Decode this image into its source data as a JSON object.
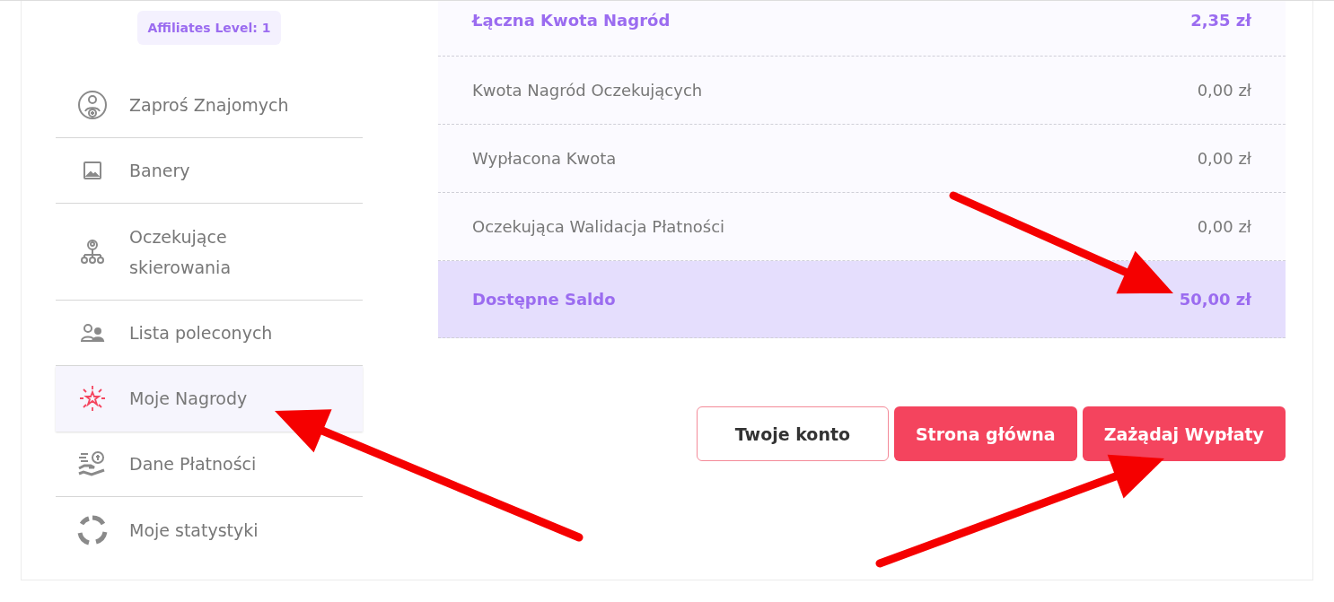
{
  "sidebar": {
    "badge": "Affiliates Level: 1",
    "items": [
      {
        "label": "Zaproś Znajomych",
        "selected": false
      },
      {
        "label": "Banery",
        "selected": false
      },
      {
        "label": "Oczekujące skierowania",
        "selected": false
      },
      {
        "label": "Lista poleconych",
        "selected": false
      },
      {
        "label": "Moje Nagrody",
        "selected": true
      },
      {
        "label": "Dane Płatności",
        "selected": false
      },
      {
        "label": "Moje statystyki",
        "selected": false
      }
    ]
  },
  "summary": {
    "rows": [
      {
        "kind": "total",
        "label": "Łączna Kwota Nagród",
        "value": "2,35 zł"
      },
      {
        "kind": "item",
        "label": "Kwota Nagród Oczekujących",
        "value": "0,00 zł"
      },
      {
        "kind": "item",
        "label": "Wypłacona Kwota",
        "value": "0,00 zł"
      },
      {
        "kind": "item",
        "label": "Oczekująca Walidacja Płatności",
        "value": "0,00 zł"
      },
      {
        "kind": "balance",
        "label": "Dostępne Saldo",
        "value": "50,00 zł"
      }
    ]
  },
  "buttons": [
    {
      "kind": "outline",
      "label": "Twoje konto"
    },
    {
      "kind": "filled",
      "label": "Strona główna"
    },
    {
      "kind": "filled",
      "label": "Zażądaj Wypłaty"
    }
  ]
}
